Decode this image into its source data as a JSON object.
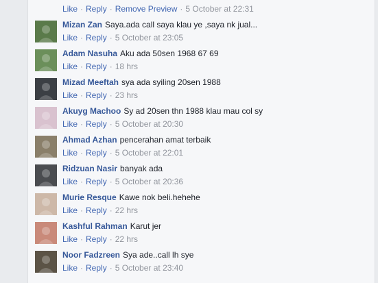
{
  "top": {
    "like": "Like",
    "reply": "Reply",
    "remove": "Remove Preview",
    "time": "5 October at 22:31"
  },
  "comments": [
    {
      "name": "Mizan Zan",
      "text": "Saya.ada call saya klau ye ,saya nk jual...",
      "like": "Like",
      "reply": "Reply",
      "time": "5 October at 23:05",
      "avatar_bg": "#5a7a4a"
    },
    {
      "name": "Adam Nasuha",
      "text": "Aku ada 50sen 1968 67 69",
      "like": "Like",
      "reply": "Reply",
      "time": "18 hrs",
      "avatar_bg": "#6b8f5a"
    },
    {
      "name": "Mizad Meeftah",
      "text": "sya ada syiling 20sen 1988",
      "like": "Like",
      "reply": "Reply",
      "time": "23 hrs",
      "avatar_bg": "#3b3f44"
    },
    {
      "name": "Akuyg Machoo",
      "text": "Sy ad 20sen thn 1988 klau mau col sy",
      "like": "Like",
      "reply": "Reply",
      "time": "5 October at 20:30",
      "avatar_bg": "#d9c2cf"
    },
    {
      "name": "Ahmad Azhan",
      "text": "pencerahan amat terbaik",
      "like": "Like",
      "reply": "Reply",
      "time": "5 October at 22:01",
      "avatar_bg": "#8a7f6a"
    },
    {
      "name": "Ridzuan Nasir",
      "text": "banyak ada",
      "like": "Like",
      "reply": "Reply",
      "time": "5 October at 20:36",
      "avatar_bg": "#4a4c50"
    },
    {
      "name": "Murie Resque",
      "text": "Kawe nok beli.hehehe",
      "like": "Like",
      "reply": "Reply",
      "time": "22 hrs",
      "avatar_bg": "#cdb8a8"
    },
    {
      "name": "Kashful Rahman",
      "text": "Karut jer",
      "like": "Like",
      "reply": "Reply",
      "time": "22 hrs",
      "avatar_bg": "#c98a7a"
    },
    {
      "name": "Noor Fadzreen",
      "text": "Sya ade..call lh sye",
      "like": "Like",
      "reply": "Reply",
      "time": "5 October at 23:40",
      "avatar_bg": "#5b5346"
    }
  ]
}
